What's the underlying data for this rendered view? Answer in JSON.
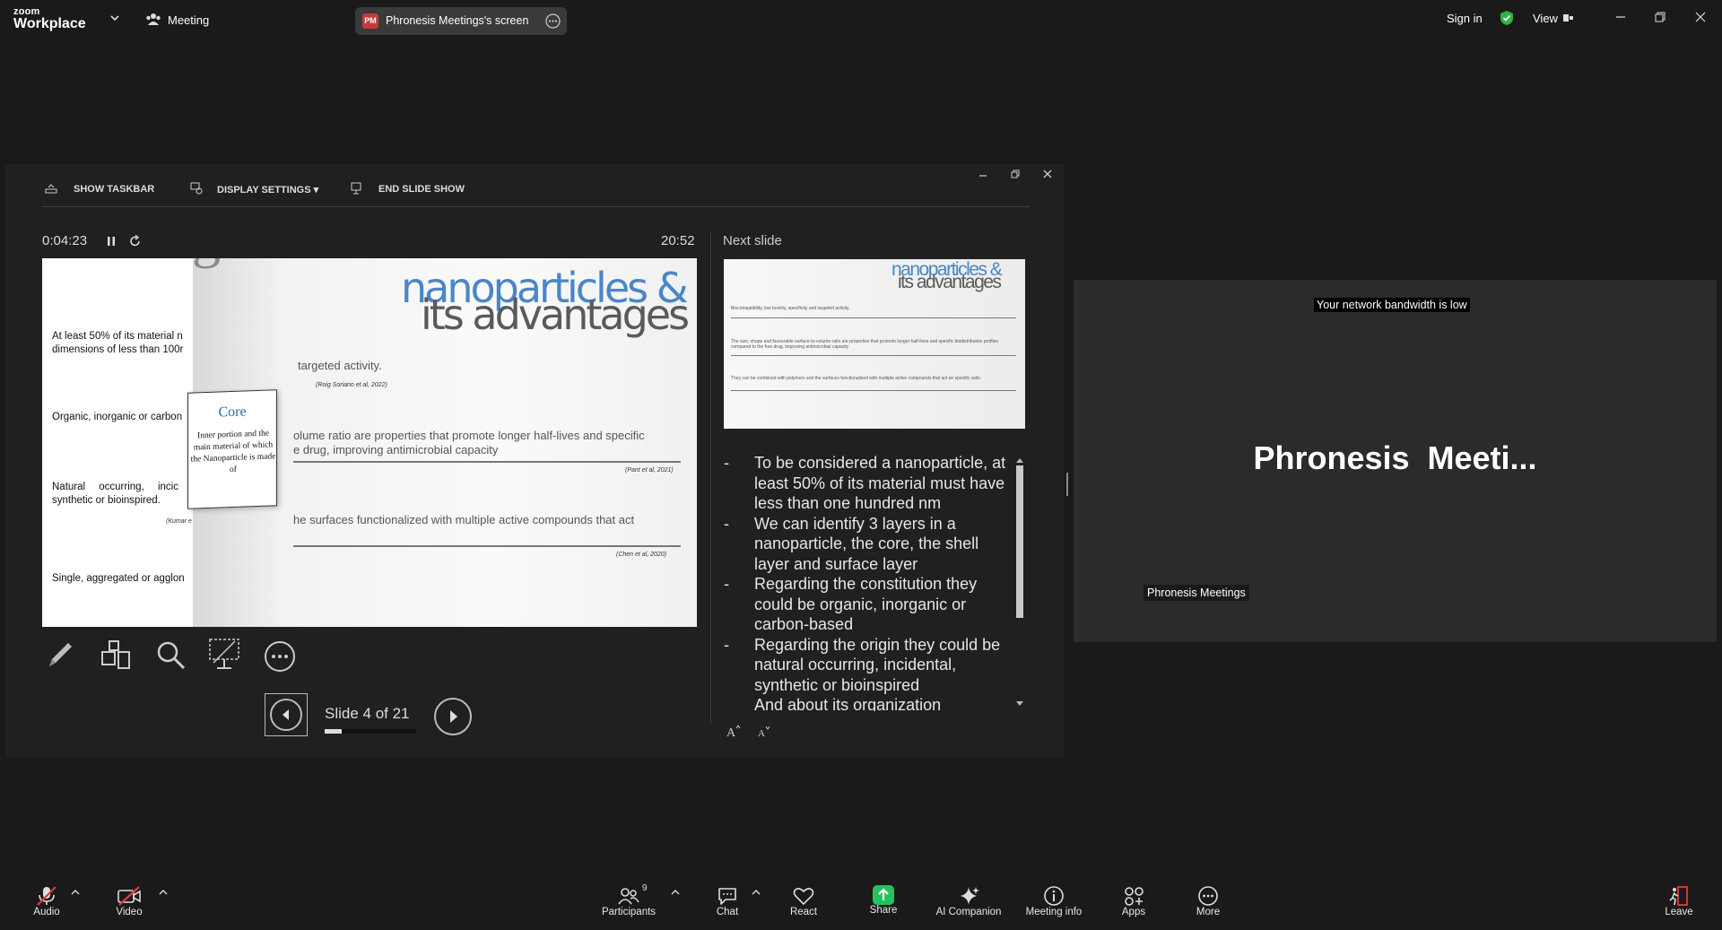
{
  "titlebar": {
    "logo_small": "zoom",
    "logo_big": "Workplace",
    "meeting_label": "Meeting",
    "share_badge": "PM",
    "share_tab_label": "Phronesis Meetings's screen",
    "sign_in": "Sign in",
    "view": "View"
  },
  "presenter": {
    "toolbar": {
      "show_taskbar": "SHOW TASKBAR",
      "display_settings": "DISPLAY SETTINGS ▾",
      "end_slide_show": "END SLIDE SHOW"
    },
    "elapsed": "0:04:23",
    "clock": "20:52",
    "next_slide_label": "Next slide",
    "slide_counter": "Slide 4 of 21",
    "progress": 0.19,
    "current_slide": {
      "title_line1": "nanoparticles &",
      "title_line2": "its advantages",
      "left_items": [
        "At least 50% of its material n",
        "dimensions of less than 100r",
        "Organic, inorganic or carbon",
        "Natural occurring, incic",
        "synthetic or bioinspired.",
        "(Kumar e",
        "Single, aggregated or agglon"
      ],
      "core_title": "Core",
      "core_text": "Inner portion and the main material of which the Nanoparticle is made of",
      "partial_heading": "ges",
      "rows": [
        {
          "text": "targeted activity.",
          "cite": "(Roig Soriano et al, 2022)"
        },
        {
          "text": "olume ratio are properties that promote longer half-lives and specific\ne drug, improving antimicrobial capacity",
          "cite": "(Pant et al, 2021)"
        },
        {
          "text": "he surfaces functionalized with multiple active compounds that act",
          "cite": "(Chen et al, 2020)"
        }
      ]
    },
    "next_slide": {
      "title_line1": "nanoparticles &",
      "title_line2": "its advantages",
      "rows": [
        "Biocompatibility, low toxicity, specificity and targeted activity.",
        "The size, shape and favourable surface-to-volume ratio are properties that promote longer half-lives and specific biodistribution profiles compared to the free drug, improving antimicrobial capacity",
        "They can be combined with polymers and the surfaces functionalized with multiple active compounds that act on specific cells."
      ]
    },
    "notes": [
      {
        "dash": "-",
        "text": "To be considered a nanoparticle, at least 50% of its material must have less than one hundred nm"
      },
      {
        "dash": "-",
        "text": "We can identify 3 layers in a nanoparticle, the core, the shell layer and surface layer"
      },
      {
        "dash": "-",
        "text": "Regarding the constitution they could be organic, inorganic or carbon-based"
      },
      {
        "dash": "-",
        "text": "Regarding the origin they could be natural occurring, incidental, synthetic or bioinspired"
      },
      {
        "dash": "",
        "text": "And about its organization"
      }
    ]
  },
  "tile": {
    "banner": "Your network bandwidth is low",
    "name_big": "Phronesis  Meeti...",
    "name_small": "Phronesis Meetings"
  },
  "bottombar": {
    "audio": "Audio",
    "video": "Video",
    "participants": "Participants",
    "participant_count": "9",
    "chat": "Chat",
    "react": "React",
    "share": "Share",
    "ai_companion": "AI Companion",
    "meeting_info": "Meeting info",
    "apps": "Apps",
    "more": "More",
    "leave": "Leave"
  },
  "colors": {
    "share_green": "#22c35e",
    "leave_red": "#e0393e",
    "slide_title_blue": "#4a86c8",
    "shield_green": "#2fb344"
  }
}
